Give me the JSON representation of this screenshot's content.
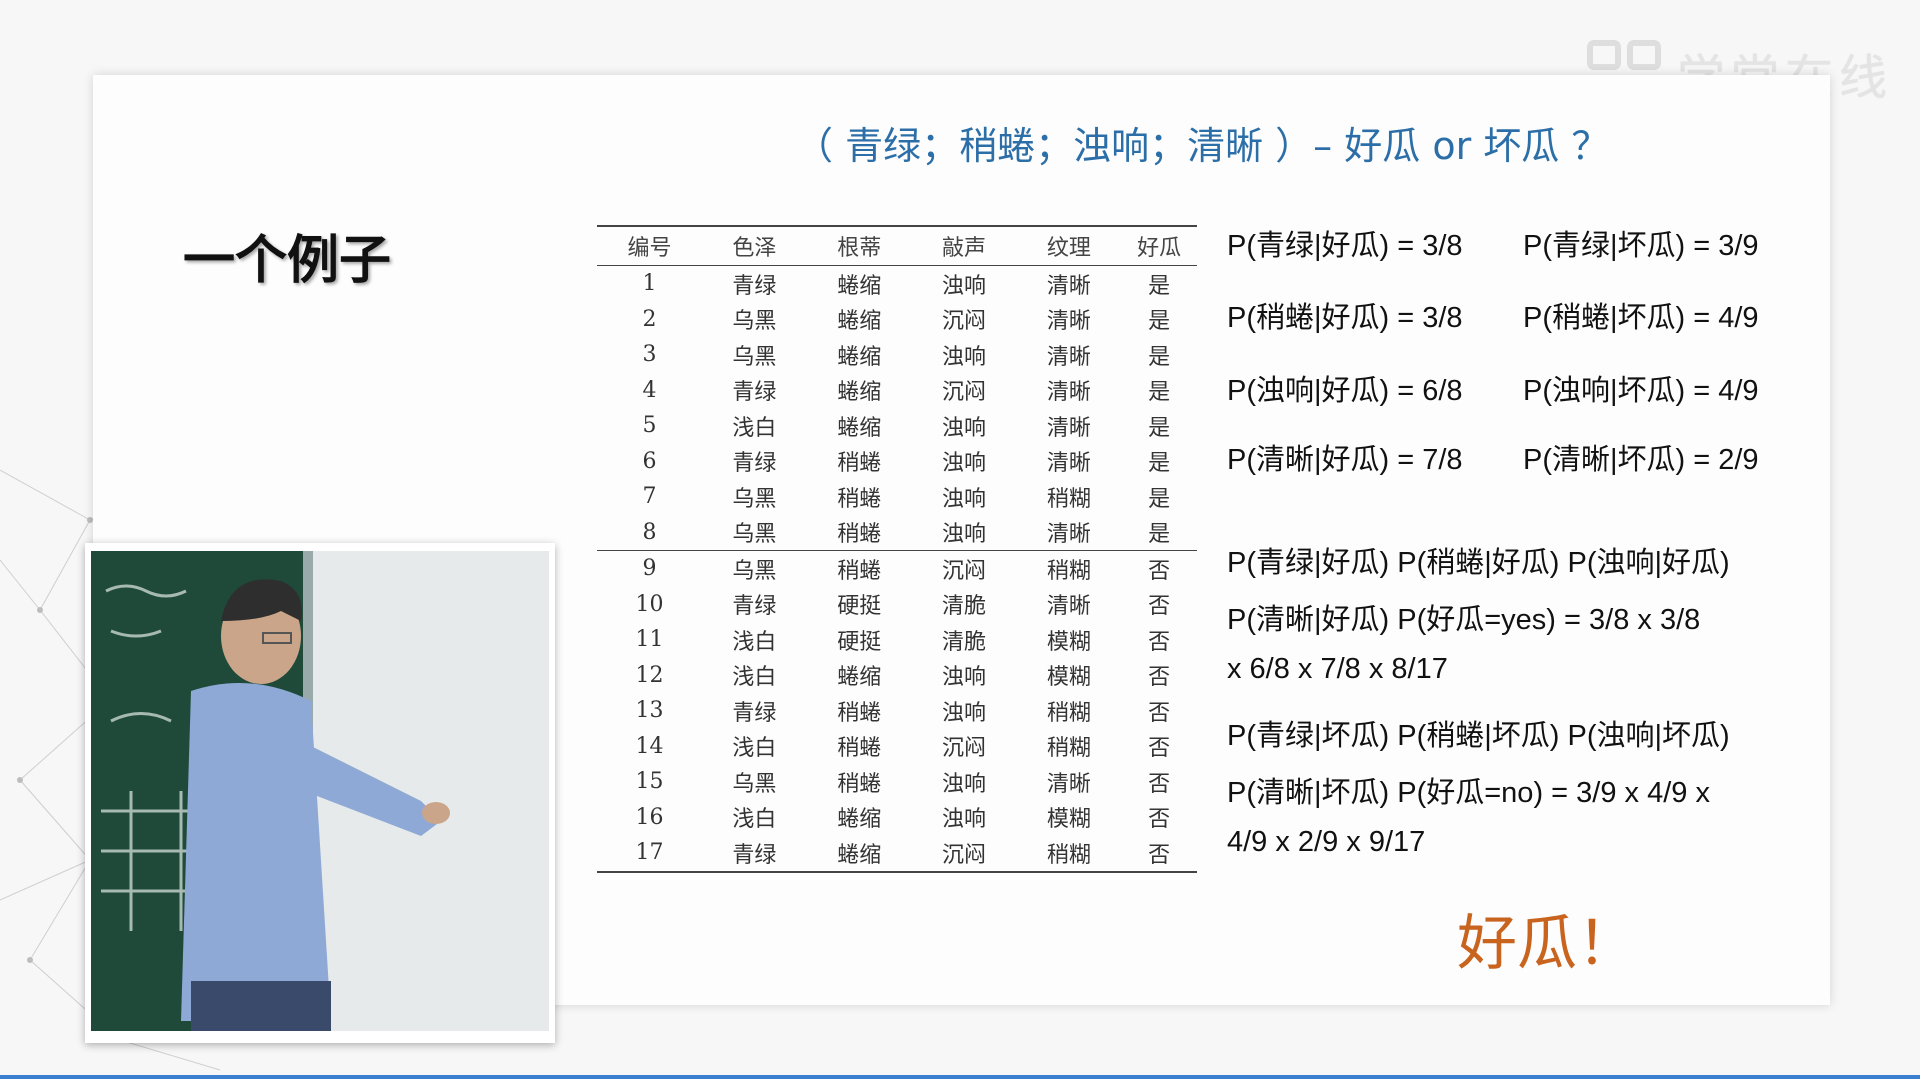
{
  "watermark": {
    "text": "学堂在线",
    "icon": "xuetangx-logo-icon"
  },
  "slide": {
    "question": "（ 青绿；稍蜷；浊响；清晰 ）– 好瓜 or 坏瓜 ？",
    "title": "一个例子",
    "table": {
      "headers": [
        "编号",
        "色泽",
        "根蒂",
        "敲声",
        "纹理",
        "好瓜"
      ],
      "rows": [
        [
          "1",
          "青绿",
          "蜷缩",
          "浊响",
          "清晰",
          "是"
        ],
        [
          "2",
          "乌黑",
          "蜷缩",
          "沉闷",
          "清晰",
          "是"
        ],
        [
          "3",
          "乌黑",
          "蜷缩",
          "浊响",
          "清晰",
          "是"
        ],
        [
          "4",
          "青绿",
          "蜷缩",
          "沉闷",
          "清晰",
          "是"
        ],
        [
          "5",
          "浅白",
          "蜷缩",
          "浊响",
          "清晰",
          "是"
        ],
        [
          "6",
          "青绿",
          "稍蜷",
          "浊响",
          "清晰",
          "是"
        ],
        [
          "7",
          "乌黑",
          "稍蜷",
          "浊响",
          "稍糊",
          "是"
        ],
        [
          "8",
          "乌黑",
          "稍蜷",
          "浊响",
          "清晰",
          "是"
        ],
        [
          "9",
          "乌黑",
          "稍蜷",
          "沉闷",
          "稍糊",
          "否"
        ],
        [
          "10",
          "青绿",
          "硬挺",
          "清脆",
          "清晰",
          "否"
        ],
        [
          "11",
          "浅白",
          "硬挺",
          "清脆",
          "模糊",
          "否"
        ],
        [
          "12",
          "浅白",
          "蜷缩",
          "浊响",
          "模糊",
          "否"
        ],
        [
          "13",
          "青绿",
          "稍蜷",
          "浊响",
          "稍糊",
          "否"
        ],
        [
          "14",
          "浅白",
          "稍蜷",
          "沉闷",
          "稍糊",
          "否"
        ],
        [
          "15",
          "乌黑",
          "稍蜷",
          "浊响",
          "清晰",
          "否"
        ],
        [
          "16",
          "浅白",
          "蜷缩",
          "浊响",
          "模糊",
          "否"
        ],
        [
          "17",
          "青绿",
          "蜷缩",
          "沉闷",
          "稍糊",
          "否"
        ]
      ]
    },
    "probabilities": [
      [
        "P(青绿|好瓜) = 3/8",
        "P(青绿|坏瓜) = 3/9"
      ],
      [
        "P(稍蜷|好瓜) = 3/8",
        "P(稍蜷|坏瓜) = 4/9"
      ],
      [
        "P(浊响|好瓜) = 6/8",
        "P(浊响|坏瓜) = 4/9"
      ],
      [
        "P(清晰|好瓜) = 7/8",
        "P(清晰|坏瓜) = 2/9"
      ]
    ],
    "calculation": [
      "P(青绿|好瓜) P(稍蜷|好瓜) P(浊响|好瓜)",
      "P(清晰|好瓜) P(好瓜=yes) = 3/8 x 3/8",
      "x 6/8 x 7/8 x 8/17",
      "P(青绿|坏瓜) P(稍蜷|坏瓜) P(浊响|坏瓜)",
      "P(清晰|坏瓜) P(好瓜=no) = 3/9 x 4/9 x",
      "4/9 x 2/9 x 9/17"
    ],
    "answer": "好瓜！"
  },
  "video": {
    "label": "lecturer-video",
    "colors": {
      "board": "#1f4a3a",
      "shirt": "#8fa9d6"
    }
  },
  "colors": {
    "question": "#2c6fa8",
    "answer": "#c8641e",
    "accent_line": "#3b7fd0"
  }
}
